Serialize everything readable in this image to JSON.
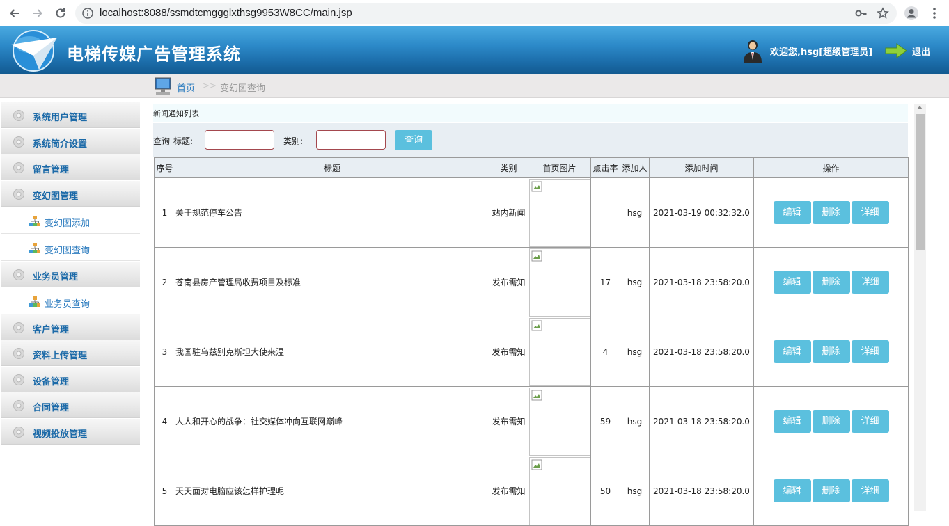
{
  "browser": {
    "url": "localhost:8088/ssmdtcmggglxthsg9953W8CC/main.jsp"
  },
  "header": {
    "title": "电梯传媒广告管理系统",
    "welcome": "欢迎您,hsg[超级管理员]",
    "logout": "退出"
  },
  "breadcrumb": {
    "home": "首页",
    "separator": ">>",
    "current": "变幻图查询"
  },
  "sidebar": {
    "groups": [
      {
        "label": "系统用户管理"
      },
      {
        "label": "系统简介设置"
      },
      {
        "label": "留言管理"
      },
      {
        "label": "变幻图管理"
      },
      {
        "label": "业务员管理"
      },
      {
        "label": "客户管理"
      },
      {
        "label": "资料上传管理"
      },
      {
        "label": "设备管理"
      },
      {
        "label": "合同管理"
      },
      {
        "label": "视频投放管理"
      }
    ],
    "subs": [
      {
        "label": "变幻图添加"
      },
      {
        "label": "变幻图查询"
      },
      {
        "label": "业务员查询"
      }
    ]
  },
  "main": {
    "panel_title": "新闻通知列表",
    "search": {
      "prefix": "查询",
      "title_label": "标题:",
      "category_label": "类别:",
      "button": "查询"
    },
    "columns": [
      "序号",
      "标题",
      "类别",
      "首页图片",
      "点击率",
      "添加人",
      "添加时间",
      "操作"
    ],
    "actions": {
      "edit": "编辑",
      "delete": "删除",
      "detail": "详细"
    },
    "rows": [
      {
        "no": "1",
        "title": "关于规范停车公告",
        "category": "站内新闻",
        "clicks": "",
        "author": "hsg",
        "time": "2021-03-19 00:32:32.0"
      },
      {
        "no": "2",
        "title": "苍南县房产管理局收费项目及标准",
        "category": "发布需知",
        "clicks": "17",
        "author": "hsg",
        "time": "2021-03-18 23:58:20.0"
      },
      {
        "no": "3",
        "title": "我国驻乌兹别克斯坦大使来温",
        "category": "发布需知",
        "clicks": "4",
        "author": "hsg",
        "time": "2021-03-18 23:58:20.0"
      },
      {
        "no": "4",
        "title": "人人和开心的战争：社交媒体冲向互联网巅峰",
        "category": "发布需知",
        "clicks": "59",
        "author": "hsg",
        "time": "2021-03-18 23:58:20.0"
      },
      {
        "no": "5",
        "title": "天天面对电脑应该怎样护理呢",
        "category": "发布需知",
        "clicks": "50",
        "author": "hsg",
        "time": "2021-03-18 23:58:20.0"
      }
    ]
  },
  "icons": {
    "back": "arrow-left-icon",
    "forward": "arrow-right-icon",
    "reload": "reload-icon",
    "info": "info-icon",
    "key": "key-icon",
    "star": "star-icon",
    "profile": "profile-icon",
    "menu": "kebab-menu-icon"
  }
}
